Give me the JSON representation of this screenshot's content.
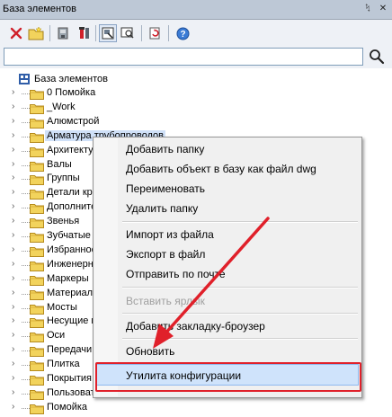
{
  "window": {
    "title": "База элементов",
    "pin_glyph": "ᛪ",
    "close_glyph": "✕"
  },
  "toolbar": {
    "buttons": [
      "delete-icon",
      "new-folder-icon",
      "prop-icon",
      "tool-icon",
      "view-icon",
      "preview-icon",
      "refresh-icon",
      "help-icon"
    ]
  },
  "search": {
    "value": "",
    "placeholder": ""
  },
  "tree": {
    "root": "База элементов",
    "items": [
      "0 Помойка",
      "_Work",
      "Алюмстрой",
      "Арматура трубопроводов",
      "Архитектура",
      "Валы",
      "Группы",
      "Детали кр",
      "Дополнительные",
      "Звенья",
      "Зубчатые к",
      "Избранное",
      "Инженерны",
      "Маркеры",
      "Материалы",
      "Мосты",
      "Несущие к",
      "Оси",
      "Передачи",
      "Плитка",
      "Покрытия",
      "Пользовательские",
      "Помойка"
    ]
  },
  "context_menu": {
    "add_folder": "Добавить папку",
    "add_object_dwg": "Добавить объект в базу как файл dwg",
    "rename": "Переименовать",
    "delete_folder": "Удалить папку",
    "import_file": "Импорт из файла",
    "export_file": "Экспорт в файл",
    "send_mail": "Отправить по почте",
    "paste_shortcut": "Вставить ярлык",
    "add_bookmark": "Добавить закладку-броузер",
    "refresh": "Обновить",
    "config_utility": "Утилита конфигурации"
  },
  "colors": {
    "title_bg": "#bdc8d6",
    "highlight": "#cfe3fb",
    "annotation_red": "#e0202a",
    "folder_yellow": "#f2d35c"
  }
}
